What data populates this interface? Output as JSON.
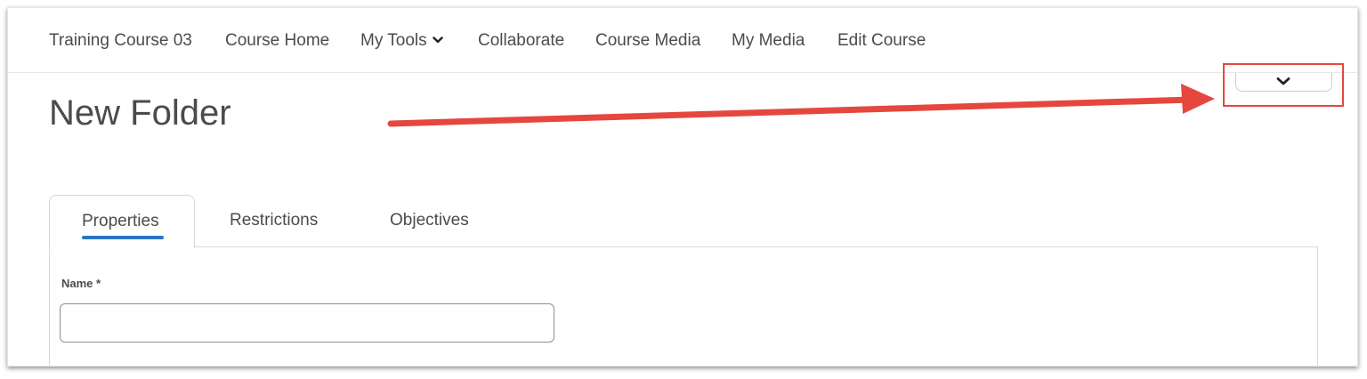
{
  "navbar": {
    "items": [
      {
        "label": "Training Course 03"
      },
      {
        "label": "Course Home"
      },
      {
        "label": "My Tools"
      },
      {
        "label": "Collaborate"
      },
      {
        "label": "Course Media"
      },
      {
        "label": "My Media"
      },
      {
        "label": "Edit Course"
      }
    ],
    "dropdown_icon": "chevron-down-icon"
  },
  "page": {
    "title": "New Folder"
  },
  "header_toggle": {
    "icon": "chevron-down-icon"
  },
  "annotation": {
    "color": "#e5473f"
  },
  "tabs": [
    {
      "label": "Properties",
      "selected": true
    },
    {
      "label": "Restrictions",
      "selected": false
    },
    {
      "label": "Objectives",
      "selected": false
    }
  ],
  "accent_color": "#2a73c6",
  "form": {
    "name_label": "Name *",
    "name_value": ""
  }
}
